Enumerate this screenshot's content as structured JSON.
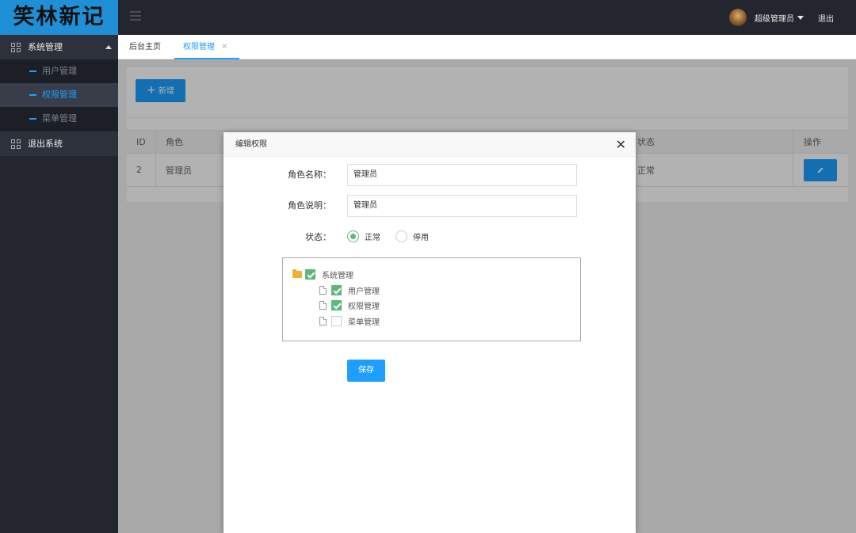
{
  "logo": {
    "text": "笑林新记"
  },
  "header": {
    "user_name": "超级管理员",
    "logout": "退出"
  },
  "sidebar": {
    "groups": [
      {
        "label": "系统管理",
        "expanded": true,
        "items": [
          {
            "label": "用户管理"
          },
          {
            "label": "权限管理",
            "active": true
          },
          {
            "label": "菜单管理"
          }
        ]
      },
      {
        "label": "退出系统"
      }
    ]
  },
  "tabs": [
    {
      "label": "后台主页"
    },
    {
      "label": "权限管理",
      "active": true,
      "close": "✕"
    }
  ],
  "toolbar": {
    "add_label": "新增",
    "add_icon": "+"
  },
  "table": {
    "headers": [
      "ID",
      "角色",
      "状态",
      "操作"
    ],
    "rows": [
      {
        "id": "2",
        "role": "管理员",
        "status": "正常"
      }
    ]
  },
  "modal": {
    "title": "编辑权限",
    "close": "✕",
    "role_name_label": "角色名称：",
    "role_name_value": "管理员",
    "role_desc_label": "角色说明：",
    "role_desc_value": "管理员",
    "status_label": "状态：",
    "status_options": [
      {
        "label": "正常",
        "checked": true
      },
      {
        "label": "停用",
        "checked": false
      }
    ],
    "tree": {
      "root": {
        "label": "系统管理",
        "checked": true
      },
      "children": [
        {
          "label": "用户管理",
          "checked": true
        },
        {
          "label": "权限管理",
          "checked": true
        },
        {
          "label": "菜单管理",
          "checked": false
        }
      ]
    },
    "save_label": "保存"
  },
  "colors": {
    "accent": "#1e9fff",
    "success": "#5fb878",
    "sidebar": "#23262e"
  }
}
